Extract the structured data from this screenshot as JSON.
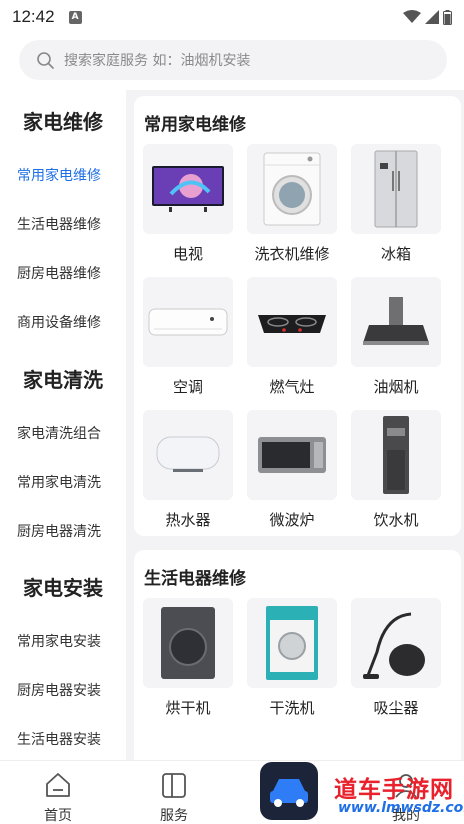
{
  "status_bar": {
    "time": "12:42",
    "notification_letter": "A"
  },
  "search": {
    "placeholder": "搜索家庭服务 如：油烟机安装"
  },
  "sidebar": {
    "groups": [
      {
        "title": "家电维修",
        "items": [
          "常用家电维修",
          "生活电器维修",
          "厨房电器维修",
          "商用设备维修"
        ]
      },
      {
        "title": "家电清洗",
        "items": [
          "家电清洗组合",
          "常用家电清洗",
          "厨房电器清洗"
        ]
      },
      {
        "title": "家电安装",
        "items": [
          "常用家电安装",
          "厨房电器安装",
          "生活电器安装"
        ]
      }
    ],
    "active_item": "常用家电维修"
  },
  "sections": [
    {
      "title": "常用家电维修",
      "items": [
        {
          "label": "电视",
          "icon": "tv-icon"
        },
        {
          "label": "洗衣机维修",
          "icon": "washing-machine-icon"
        },
        {
          "label": "冰箱",
          "icon": "refrigerator-icon"
        },
        {
          "label": "空调",
          "icon": "air-conditioner-icon"
        },
        {
          "label": "燃气灶",
          "icon": "gas-stove-icon"
        },
        {
          "label": "油烟机",
          "icon": "range-hood-icon"
        },
        {
          "label": "热水器",
          "icon": "water-heater-icon"
        },
        {
          "label": "微波炉",
          "icon": "microwave-icon"
        },
        {
          "label": "饮水机",
          "icon": "water-dispenser-icon"
        }
      ]
    },
    {
      "title": "生活电器维修",
      "items": [
        {
          "label": "烘干机",
          "icon": "dryer-icon"
        },
        {
          "label": "干洗机",
          "icon": "dry-cleaning-machine-icon"
        },
        {
          "label": "吸尘器",
          "icon": "vacuum-cleaner-icon"
        }
      ]
    }
  ],
  "bottom_nav": [
    {
      "label": "首页",
      "icon": "home-icon"
    },
    {
      "label": "服务",
      "icon": "service-icon"
    },
    {
      "label": "我的",
      "icon": "profile-icon"
    }
  ],
  "watermark": {
    "text": "道车手游网",
    "url": "www.lmwsdz.com"
  },
  "colors": {
    "accent": "#1e6fe8",
    "background": "#f3f3f5",
    "watermark_red": "#e8212c"
  }
}
